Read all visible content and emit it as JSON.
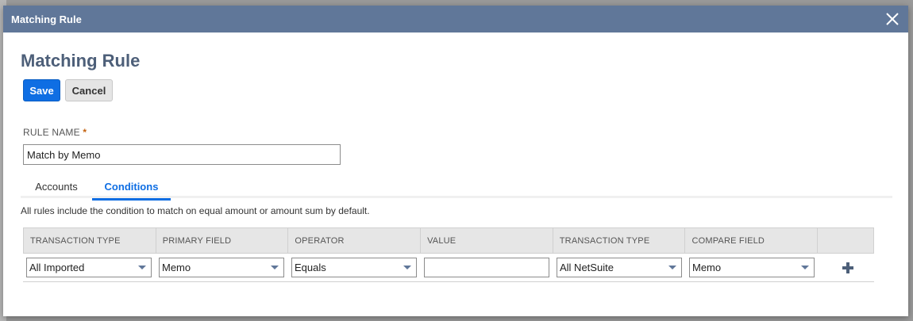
{
  "dialog": {
    "title": "Matching Rule",
    "heading": "Matching Rule"
  },
  "buttons": {
    "save": "Save",
    "cancel": "Cancel"
  },
  "rule_name": {
    "label": "RULE NAME",
    "required_marker": "*",
    "value": "Match by Memo"
  },
  "tabs": [
    {
      "label": "Accounts",
      "active": false
    },
    {
      "label": "Conditions",
      "active": true
    }
  ],
  "info_text": "All rules include the condition to match on equal amount or amount sum by default.",
  "grid": {
    "columns": [
      "TRANSACTION TYPE",
      "PRIMARY FIELD",
      "OPERATOR",
      "VALUE",
      "TRANSACTION TYPE",
      "COMPARE FIELD"
    ],
    "row": {
      "transaction_type": "All Imported",
      "primary_field": "Memo",
      "operator": "Equals",
      "value": "",
      "compare_transaction_type": "All NetSuite",
      "compare_field": "Memo"
    }
  },
  "icons": {
    "close": "close-icon",
    "add": "plus-icon",
    "dropdown": "chevron-down-icon"
  },
  "colors": {
    "titlebar": "#607799",
    "accent": "#0f6ee3",
    "heading": "#4d5f79"
  }
}
